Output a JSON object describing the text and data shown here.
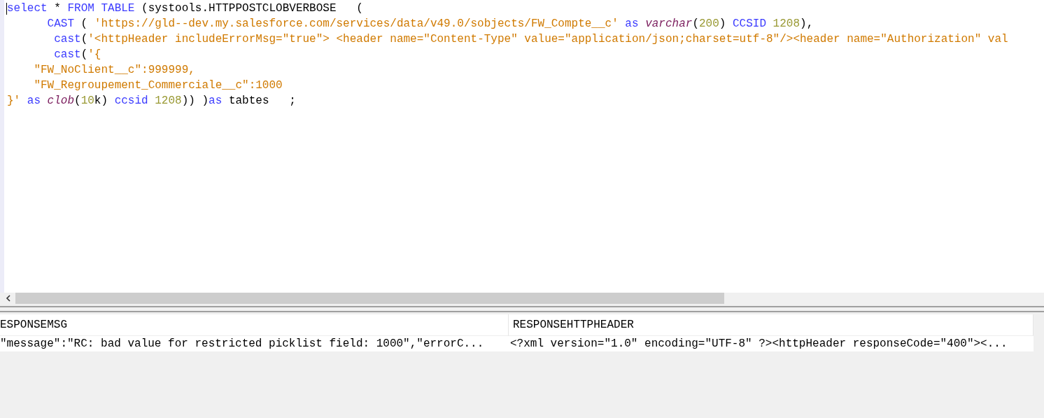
{
  "editor": {
    "lines": [
      {
        "tokens": [
          {
            "kind": "keyword",
            "text": "select"
          },
          {
            "kind": "plain",
            "text": " * "
          },
          {
            "kind": "keyword",
            "text": "FROM TABLE"
          },
          {
            "kind": "plain",
            "text": " (systools.HTTPPOSTCLOBVERBOSE   ("
          }
        ]
      },
      {
        "tokens": [
          {
            "kind": "keyword",
            "text": "      CAST"
          },
          {
            "kind": "plain",
            "text": " ( "
          },
          {
            "kind": "string",
            "text": "'https://gld--dev.my.salesforce.com/services/data/v49.0/sobjects/FW_Compte__c'"
          },
          {
            "kind": "keyword",
            "text": " as "
          },
          {
            "kind": "function",
            "text": "varchar"
          },
          {
            "kind": "plain",
            "text": "("
          },
          {
            "kind": "number",
            "text": "200"
          },
          {
            "kind": "plain",
            "text": ") "
          },
          {
            "kind": "keyword",
            "text": "CCSID"
          },
          {
            "kind": "number",
            "text": " 1208"
          },
          {
            "kind": "plain",
            "text": "),"
          }
        ]
      },
      {
        "tokens": [
          {
            "kind": "keyword",
            "text": "       cast"
          },
          {
            "kind": "plain",
            "text": "("
          },
          {
            "kind": "string",
            "text": "'<httpHeader includeErrorMsg=\"true\"> <header name=\"Content-Type\" value=\"application/json;charset=utf-8\"/><header name=\"Authorization\" val"
          }
        ]
      },
      {
        "tokens": [
          {
            "kind": "keyword",
            "text": "       cast"
          },
          {
            "kind": "plain",
            "text": "("
          },
          {
            "kind": "string",
            "text": "'{"
          }
        ]
      },
      {
        "tokens": [
          {
            "kind": "string",
            "text": "    \"FW_NoClient__c\":999999,"
          }
        ]
      },
      {
        "tokens": [
          {
            "kind": "string",
            "text": "    \"FW_Regroupement_Commerciale__c\":1000"
          }
        ]
      },
      {
        "tokens": [
          {
            "kind": "string",
            "text": "}'"
          },
          {
            "kind": "keyword",
            "text": " as "
          },
          {
            "kind": "function",
            "text": "clob"
          },
          {
            "kind": "plain",
            "text": "("
          },
          {
            "kind": "number",
            "text": "10"
          },
          {
            "kind": "plain",
            "text": "k) "
          },
          {
            "kind": "keyword",
            "text": "ccsid"
          },
          {
            "kind": "number",
            "text": " 1208"
          },
          {
            "kind": "plain",
            "text": ")) )"
          },
          {
            "kind": "keyword",
            "text": "as"
          },
          {
            "kind": "plain",
            "text": " tabtes   ;"
          }
        ]
      }
    ]
  },
  "results": {
    "columns": [
      "ESPONSEMSG",
      "RESPONSEHTTPHEADER"
    ],
    "rows": [
      [
        "\"message\":\"RC: bad value for restricted picklist field: 1000\",\"errorC...",
        "<?xml version=\"1.0\" encoding=\"UTF-8\" ?><httpHeader responseCode=\"400\"><..."
      ]
    ]
  }
}
